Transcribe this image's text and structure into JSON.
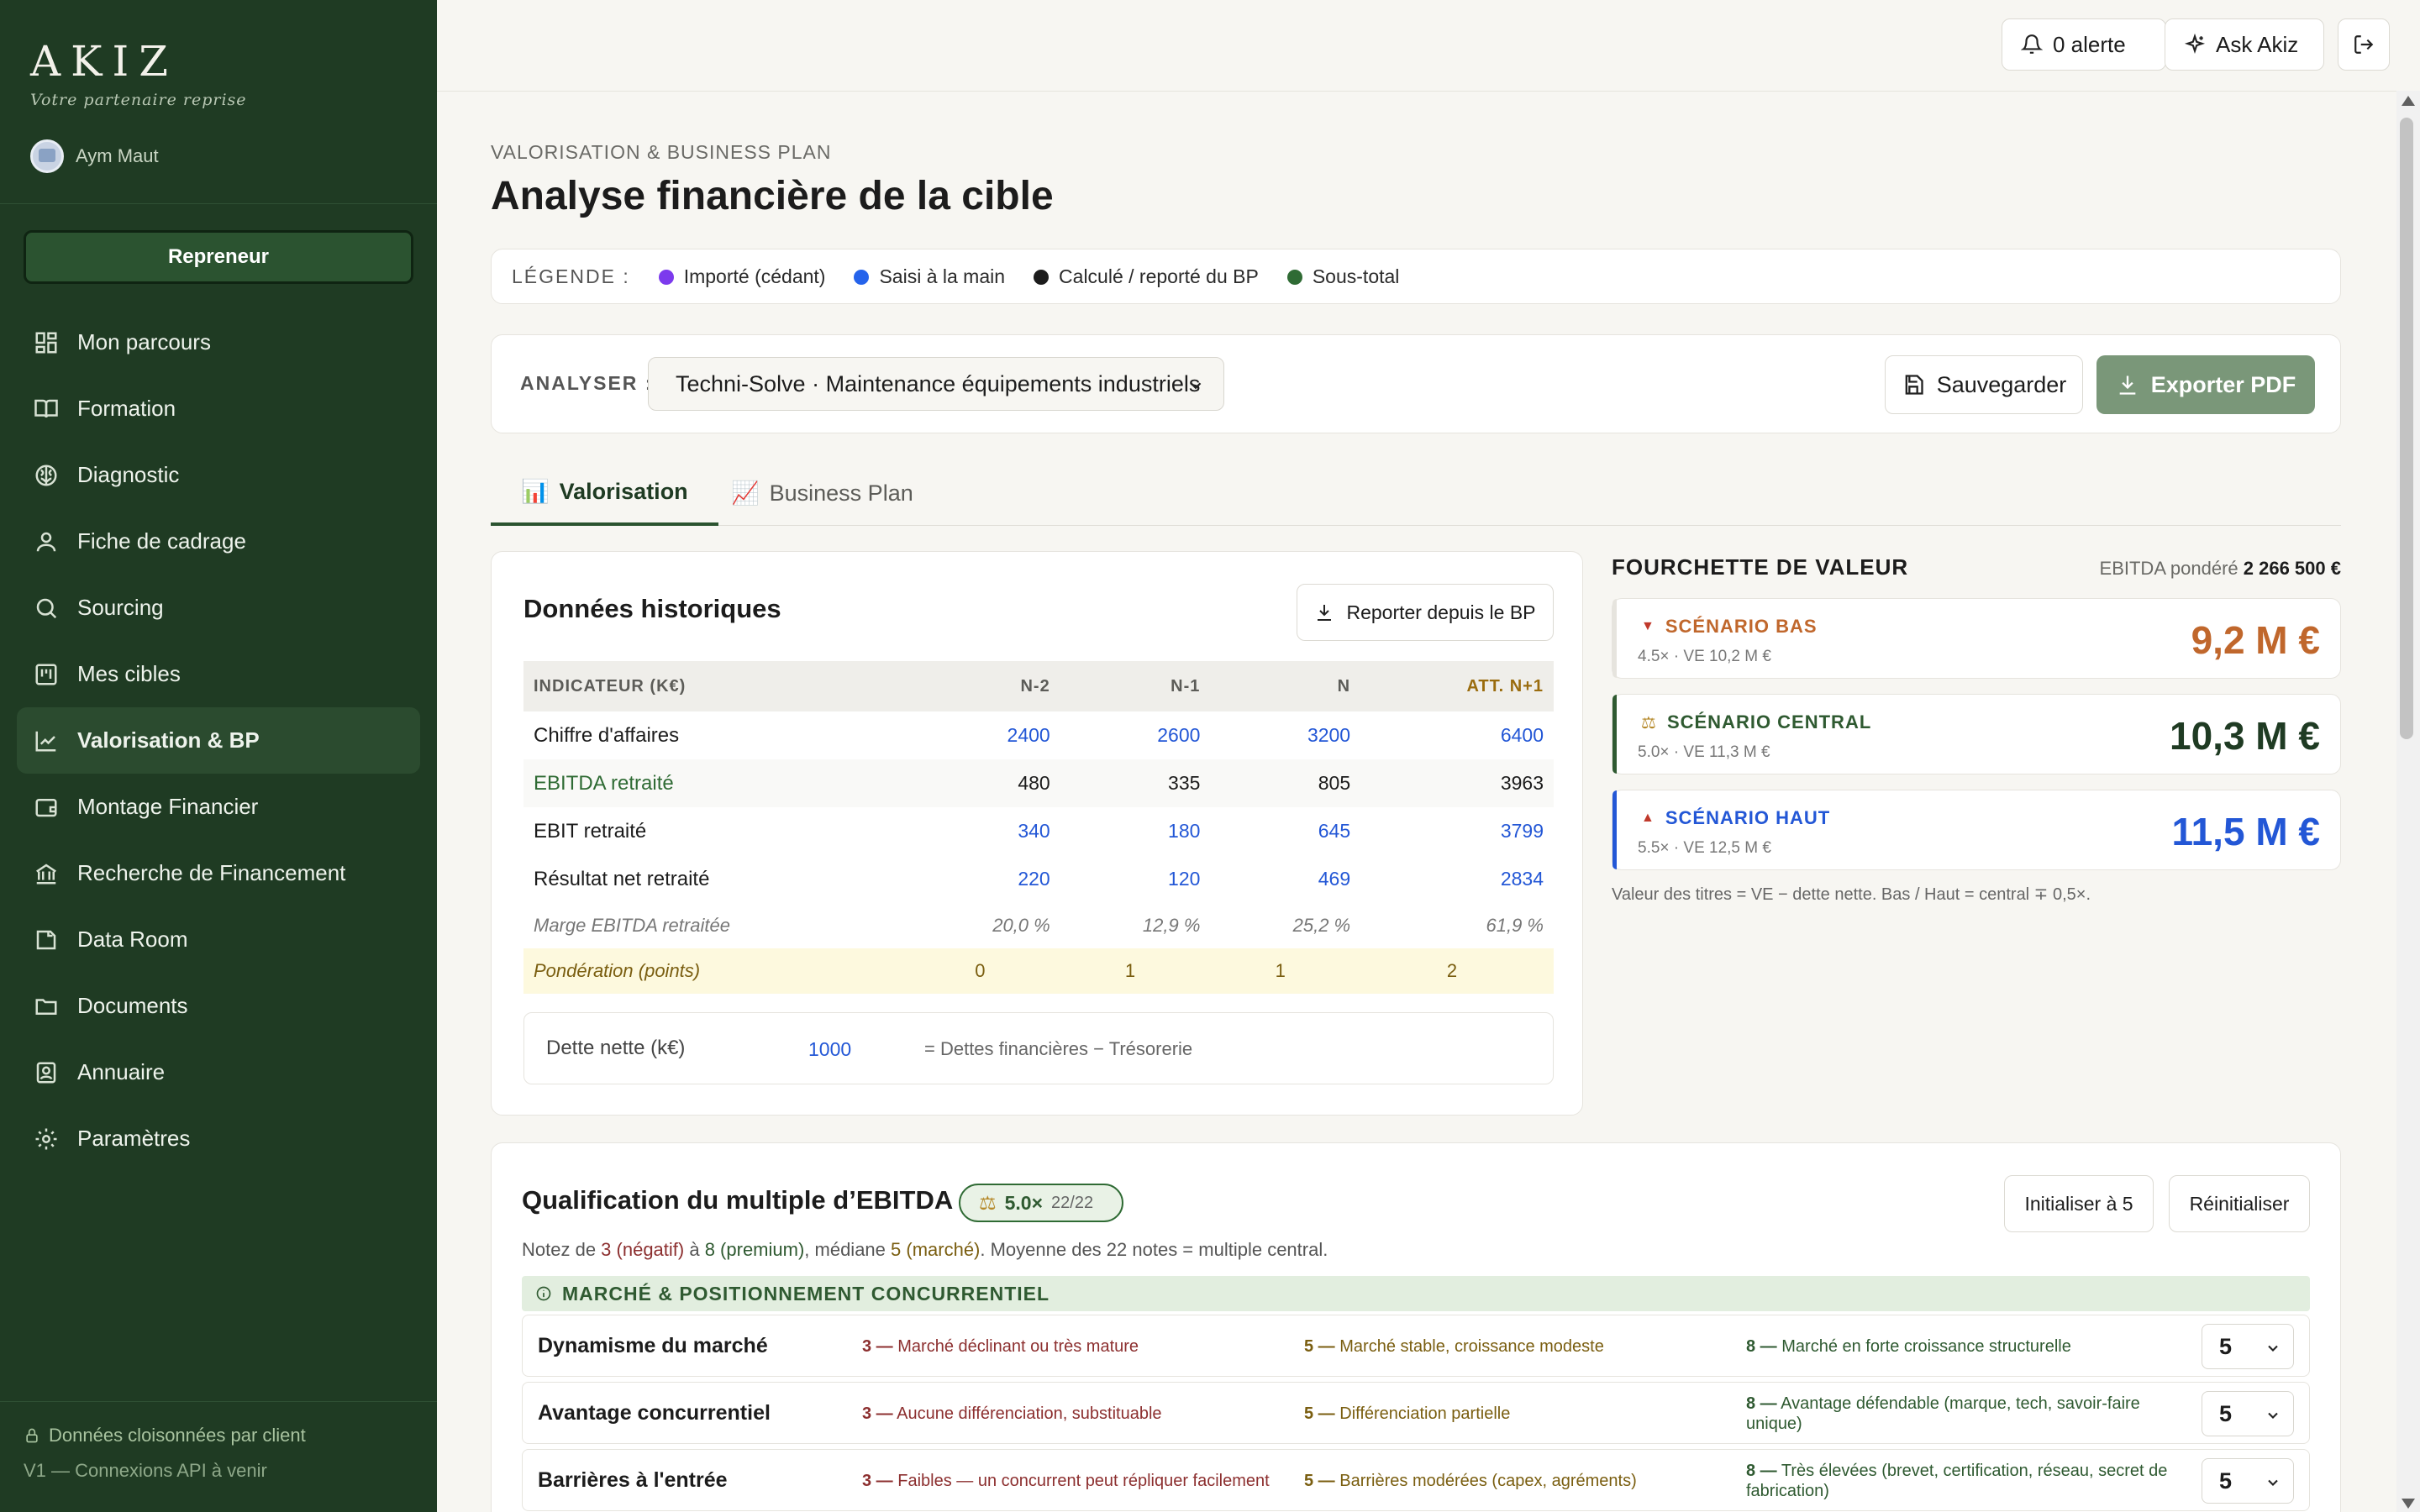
{
  "brand": {
    "name": "AKIZ",
    "tagline": "Votre partenaire reprise"
  },
  "user": {
    "name": "Aym Maut"
  },
  "role_button": "Repreneur",
  "nav": [
    {
      "label": "Mon parcours",
      "icon": "grid-icon"
    },
    {
      "label": "Formation",
      "icon": "book-icon"
    },
    {
      "label": "Diagnostic",
      "icon": "brain-icon"
    },
    {
      "label": "Fiche de cadrage",
      "icon": "user-icon"
    },
    {
      "label": "Sourcing",
      "icon": "search-icon"
    },
    {
      "label": "Mes cibles",
      "icon": "kanban-icon"
    },
    {
      "label": "Valorisation & BP",
      "icon": "chart-line-icon",
      "active": true
    },
    {
      "label": "Montage Financier",
      "icon": "wallet-icon"
    },
    {
      "label": "Recherche de Financement",
      "icon": "bank-icon"
    },
    {
      "label": "Data Room",
      "icon": "briefcase-icon"
    },
    {
      "label": "Documents",
      "icon": "folder-icon"
    },
    {
      "label": "Annuaire",
      "icon": "contact-icon"
    },
    {
      "label": "Paramètres",
      "icon": "gear-icon"
    }
  ],
  "sidebar_footer": {
    "line1": "Données cloisonnées par client",
    "line2": "V1 — Connexions API à venir"
  },
  "topbar": {
    "alerts": "0 alerte",
    "ask": "Ask Akiz"
  },
  "page": {
    "eyebrow": "VALORISATION & BUSINESS PLAN",
    "title": "Analyse financière de la cible"
  },
  "legend": {
    "label": "LÉGENDE :",
    "items": [
      {
        "label": "Importé (cédant)",
        "color": "#7c3aed"
      },
      {
        "label": "Saisi à la main",
        "color": "#2563eb"
      },
      {
        "label": "Calculé / reporté du BP",
        "color": "#1c1c1c"
      },
      {
        "label": "Sous-total",
        "color": "#2f6b34"
      }
    ]
  },
  "analyse": {
    "label": "ANALYSER :",
    "selected": "Techni-Solve · Maintenance équipements industriels",
    "save": "Sauvegarder",
    "export": "Exporter PDF"
  },
  "tabs": [
    {
      "label": "Valorisation",
      "icon": "📊"
    },
    {
      "label": "Business Plan",
      "icon": "📈"
    }
  ],
  "historique": {
    "title": "Données historiques",
    "report_button": "Reporter depuis le BP",
    "headers": [
      "INDICATEUR (K€)",
      "N-2",
      "N-1",
      "N",
      "ATT. N+1"
    ],
    "rows": [
      {
        "label": "Chiffre d'affaires",
        "values": [
          "2400",
          "2600",
          "3200",
          "6400"
        ]
      },
      {
        "label": "EBITDA retraité",
        "values": [
          "480",
          "335",
          "805",
          "3963"
        ]
      },
      {
        "label": "EBIT retraité",
        "values": [
          "340",
          "180",
          "645",
          "3799"
        ]
      },
      {
        "label": "Résultat net retraité",
        "values": [
          "220",
          "120",
          "469",
          "2834"
        ]
      }
    ],
    "marge": {
      "label": "Marge EBITDA retraitée",
      "values": [
        "20,0 %",
        "12,9 %",
        "25,2 %",
        "61,9 %"
      ]
    },
    "ponderation": {
      "label": "Pondération (points)",
      "values": [
        "0",
        "1",
        "1",
        "2"
      ]
    },
    "dette": {
      "label": "Dette nette (k€)",
      "value": "1000",
      "note": "= Dettes financières − Trésorerie"
    }
  },
  "fourchette": {
    "title": "FOURCHETTE DE VALEUR",
    "ebitda_label": "EBITDA pondéré",
    "ebitda_value": "2 266 500 €",
    "scenarios": [
      {
        "name": "SCÉNARIO BAS",
        "sub": "4.5× · VE 10,2 M €",
        "value": "9,2 M €",
        "color": "#c0672c",
        "icon": "▼"
      },
      {
        "name": "SCÉNARIO CENTRAL",
        "sub": "5.0× · VE 11,3 M €",
        "value": "10,3 M €",
        "color": "#2f5a31",
        "icon": "⚖"
      },
      {
        "name": "SCÉNARIO HAUT",
        "sub": "5.5× · VE 12,5 M €",
        "value": "11,5 M €",
        "color": "#2357d6",
        "icon": "▲"
      }
    ],
    "note": "Valeur des titres = VE − dette nette. Bas / Haut = central ∓ 0,5×."
  },
  "qualification": {
    "title": "Qualification du multiple d’EBITDA",
    "badge_value": "5.0×",
    "badge_count": "22/22",
    "init_button": "Initialiser à 5",
    "reset_button": "Réinitialiser",
    "note_parts": [
      "Notez de ",
      "3 (négatif)",
      " à ",
      "8 (premium)",
      ", médiane ",
      "5 (marché)",
      ". Moyenne des 22 notes = multiple central."
    ],
    "section": "MARCHÉ & POSITIONNEMENT CONCURRENTIEL",
    "rows": [
      {
        "label": "Dynamisme du marché",
        "o3": "Marché déclinant ou très mature",
        "o5": "Marché stable, croissance modeste",
        "o8": "Marché en forte croissance structurelle",
        "value": "5"
      },
      {
        "label": "Avantage concurrentiel",
        "o3": "Aucune différenciation, substituable",
        "o5": "Différenciation partielle",
        "o8": "Avantage défendable (marque, tech, savoir-faire unique)",
        "value": "5"
      },
      {
        "label": "Barrières à l'entrée",
        "o3": "Faibles — un concurrent peut répliquer facilement",
        "o5": "Barrières modérées (capex, agréments)",
        "o8": "Très élevées (brevet, certification, réseau, secret de fabrication)",
        "value": "5"
      }
    ],
    "score_labels": {
      "s3": "3 —",
      "s5": "5 —",
      "s8": "8 —"
    }
  }
}
